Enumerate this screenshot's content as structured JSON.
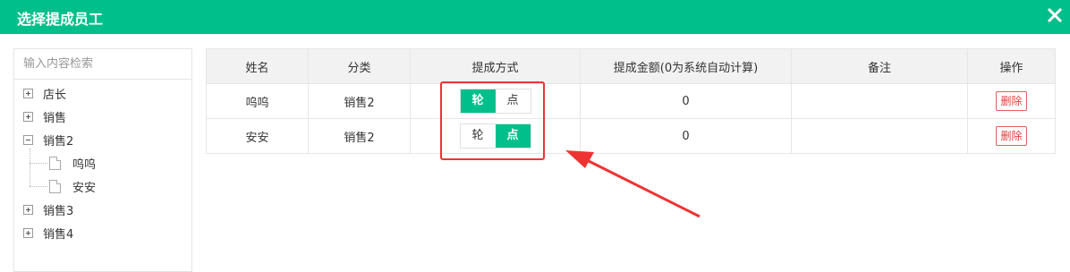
{
  "dialog": {
    "title": "选择提成员工"
  },
  "tree": {
    "search_placeholder": "输入内容检索",
    "nodes": [
      {
        "label": "店长",
        "type": "folder"
      },
      {
        "label": "销售",
        "type": "folder"
      },
      {
        "label": "销售2",
        "type": "folder-open"
      },
      {
        "label": "呜呜",
        "type": "leaf"
      },
      {
        "label": "安安",
        "type": "leaf"
      },
      {
        "label": "销售3",
        "type": "folder"
      },
      {
        "label": "销售4",
        "type": "folder"
      }
    ]
  },
  "table": {
    "headers": [
      "姓名",
      "分类",
      "提成方式",
      "提成金额(0为系统自动计算)",
      "备注",
      "操作"
    ],
    "rows": [
      {
        "name": "呜呜",
        "category": "销售2",
        "mode_options": [
          "轮",
          "点"
        ],
        "selected_mode": "轮",
        "amount": "0",
        "note": "",
        "action": "删除"
      },
      {
        "name": "安安",
        "category": "销售2",
        "mode_options": [
          "轮",
          "点"
        ],
        "selected_mode": "点",
        "amount": "0",
        "note": "",
        "action": "删除"
      }
    ]
  },
  "colors": {
    "accent": "#01bf8a",
    "annotation": "#e33333",
    "delete": "#e04040"
  },
  "icons": {
    "close": "close-icon",
    "expander": "plus-box-icon",
    "collapser": "minus-box-icon",
    "leaf": "document-icon"
  }
}
